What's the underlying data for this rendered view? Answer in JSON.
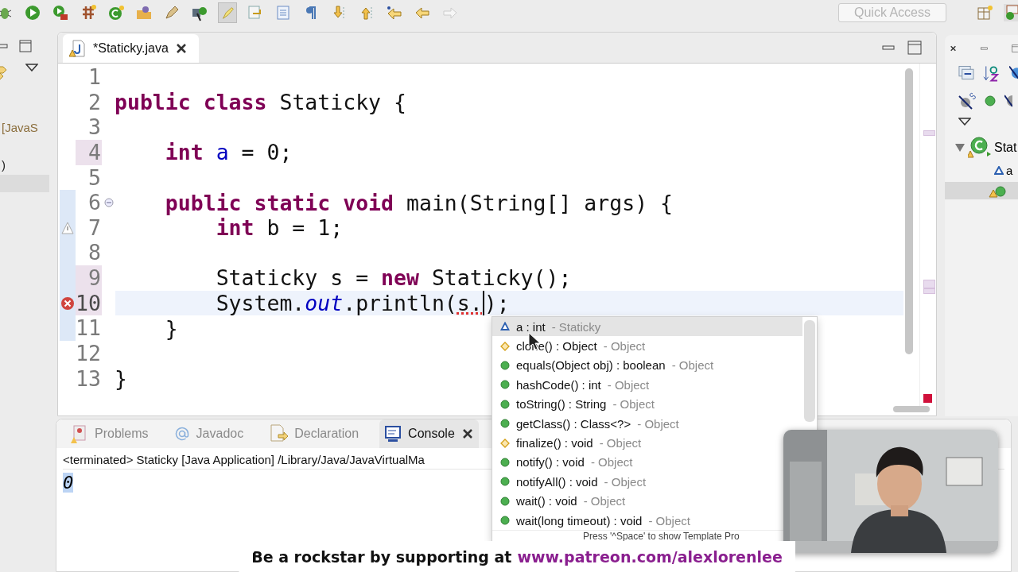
{
  "toolbar": {
    "highlight_toggle_on": true,
    "quick_access": {
      "placeholder": "Quick Access"
    }
  },
  "left_panel": {
    "items": [
      {
        "text": "[JavaS",
        "kind": "project"
      },
      {
        "text": ")",
        "kind": "plain"
      }
    ]
  },
  "editor": {
    "tab": {
      "title": "*Staticky.java",
      "selected": true
    },
    "lines": [
      {
        "number": "1",
        "kind": "plain",
        "changed": false,
        "scope": false,
        "current": false
      },
      {
        "number": "2",
        "kind": "plain",
        "changed": false,
        "scope": false,
        "current": false,
        "tokens": [
          {
            "kind": "keyword",
            "text": "public "
          },
          {
            "kind": "keyword",
            "text": "class "
          },
          {
            "kind": "plain",
            "text": "Staticky {"
          }
        ]
      },
      {
        "number": "3",
        "kind": "plain",
        "changed": false,
        "scope": false,
        "current": false
      },
      {
        "number": "4",
        "kind": "plain",
        "changed": true,
        "scope": false,
        "current": false,
        "tokens": [
          {
            "kind": "keyword",
            "text": "    int "
          },
          {
            "kind": "field",
            "text": "a"
          },
          {
            "kind": "plain",
            "text": " = 0;"
          }
        ]
      },
      {
        "number": "5",
        "kind": "plain",
        "changed": false,
        "scope": false,
        "current": false
      },
      {
        "number": "6",
        "kind": "fold",
        "changed": false,
        "scope": true,
        "current": false,
        "tokens": [
          {
            "kind": "keyword",
            "text": "    public "
          },
          {
            "kind": "keyword",
            "text": "static "
          },
          {
            "kind": "keyword",
            "text": "void "
          },
          {
            "kind": "plain",
            "text": "main(String[] args) {"
          }
        ]
      },
      {
        "number": "7",
        "kind": "warning",
        "changed": false,
        "scope": true,
        "current": false,
        "tokens": [
          {
            "kind": "keyword",
            "text": "        int "
          },
          {
            "kind": "plain",
            "text": "b = 1;"
          }
        ]
      },
      {
        "number": "8",
        "kind": "plain",
        "changed": false,
        "scope": true,
        "current": false
      },
      {
        "number": "9",
        "kind": "plain",
        "changed": true,
        "scope": true,
        "current": false,
        "tokens": [
          {
            "kind": "plain",
            "text": "        Staticky s = "
          },
          {
            "kind": "keyword",
            "text": "new "
          },
          {
            "kind": "plain",
            "text": "Staticky();"
          }
        ]
      },
      {
        "number": "10",
        "kind": "error",
        "changed": true,
        "scope": true,
        "current": true,
        "tokens": [
          {
            "kind": "plain",
            "text": "        System."
          },
          {
            "kind": "static",
            "text": "out"
          },
          {
            "kind": "plain",
            "text": ".println("
          },
          {
            "kind": "error",
            "text": "s."
          },
          {
            "kind": "plain",
            "text": ");"
          }
        ]
      },
      {
        "number": "11",
        "kind": "plain",
        "changed": false,
        "scope": true,
        "current": false,
        "tokens": [
          {
            "kind": "plain",
            "text": "    }"
          }
        ]
      },
      {
        "number": "12",
        "kind": "plain",
        "changed": false,
        "scope": false,
        "current": false
      },
      {
        "number": "13",
        "kind": "plain",
        "changed": false,
        "scope": false,
        "current": false,
        "tokens": [
          {
            "kind": "plain",
            "text": "}"
          }
        ]
      }
    ]
  },
  "completion": {
    "items": [
      {
        "kind": "field",
        "name": "a : int",
        "owner": "- Staticky",
        "selected": true
      },
      {
        "kind": "protected",
        "name": "clone() : Object",
        "owner": "- Object",
        "selected": false
      },
      {
        "kind": "public",
        "name": "equals(Object obj) : boolean",
        "owner": "- Object",
        "selected": false
      },
      {
        "kind": "public",
        "name": "hashCode() : int",
        "owner": "- Object",
        "selected": false
      },
      {
        "kind": "public",
        "name": "toString() : String",
        "owner": "- Object",
        "selected": false
      },
      {
        "kind": "public",
        "name": "getClass() : Class<?>",
        "owner": "- Object",
        "selected": false
      },
      {
        "kind": "protected",
        "name": "finalize() : void",
        "owner": "- Object",
        "selected": false
      },
      {
        "kind": "public",
        "name": "notify() : void",
        "owner": "- Object",
        "selected": false
      },
      {
        "kind": "public",
        "name": "notifyAll() : void",
        "owner": "- Object",
        "selected": false
      },
      {
        "kind": "public",
        "name": "wait() : void",
        "owner": "- Object",
        "selected": false
      },
      {
        "kind": "public",
        "name": "wait(long timeout) : void",
        "owner": "- Object",
        "selected": false
      }
    ],
    "footer": "Press '^Space' to show Template Pro"
  },
  "bottom_panel": {
    "tabs": [
      {
        "label": "Problems",
        "kind": "problems",
        "selected": false
      },
      {
        "label": "Javadoc",
        "kind": "javadoc",
        "selected": false
      },
      {
        "label": "Declaration",
        "kind": "declaration",
        "selected": false
      },
      {
        "label": "Console",
        "kind": "console",
        "selected": true
      }
    ],
    "console": {
      "header": "<terminated> Staticky [Java Application] /Library/Java/JavaVirtualMa",
      "output": "0"
    }
  },
  "outline": {
    "items": [
      {
        "text": "Stat",
        "kind": "class",
        "expanded": true,
        "children": [
          {
            "text": "a",
            "kind": "field"
          }
        ]
      }
    ]
  },
  "banner": {
    "text": "Be a rockstar by supporting at",
    "link": "www.patreon.com/alexlorenlee"
  }
}
